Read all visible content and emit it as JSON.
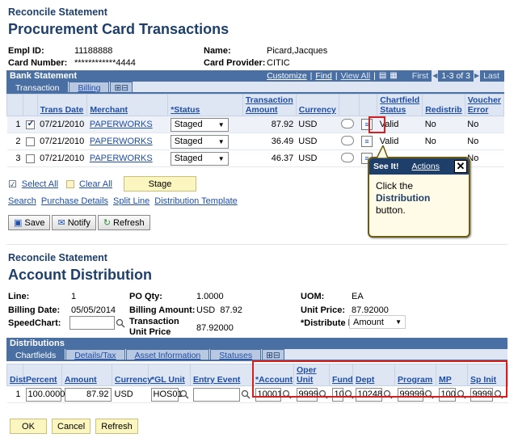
{
  "top": {
    "section": "Reconcile Statement",
    "title": "Procurement Card Transactions",
    "empl_id_label": "Empl ID:",
    "empl_id": "11188888",
    "card_label": "Card Number:",
    "card": "************4444",
    "name_label": "Name:",
    "name": "Picard,Jacques",
    "provider_label": "Card Provider:",
    "provider": "CITIC"
  },
  "bank": {
    "header": "Bank Statement",
    "customize": "Customize",
    "find": "Find",
    "view_all": "View All",
    "first": "First",
    "range": "1-3 of 3",
    "last": "Last",
    "tabs": [
      "Transaction",
      "Billing"
    ],
    "columns": [
      "Trans Date",
      "Merchant",
      "*Status",
      "Transaction Amount",
      "Currency",
      "Chartfield Status",
      "Redistrib",
      "Voucher Error"
    ],
    "rows": [
      {
        "n": "1",
        "checked": true,
        "date": "07/21/2010",
        "merchant": "PAPERWORKS",
        "status": "Staged",
        "amount": "87.92",
        "currency": "USD",
        "cf": "Valid",
        "redist": "No",
        "verr": "No"
      },
      {
        "n": "2",
        "checked": false,
        "date": "07/21/2010",
        "merchant": "PAPERWORKS",
        "status": "Staged",
        "amount": "36.49",
        "currency": "USD",
        "cf": "Valid",
        "redist": "No",
        "verr": "No"
      },
      {
        "n": "3",
        "checked": false,
        "date": "07/21/2010",
        "merchant": "PAPERWORKS",
        "status": "Staged",
        "amount": "46.37",
        "currency": "USD",
        "cf": "",
        "redist": "",
        "verr": "No"
      }
    ]
  },
  "actions": {
    "select_all": "Select All",
    "clear_all": "Clear All",
    "stage": "Stage",
    "links": [
      "Search",
      "Purchase Details",
      "Split Line",
      "Distribution Template"
    ],
    "save": "Save",
    "notify": "Notify",
    "refresh": "Refresh"
  },
  "callout": {
    "see_it": "See It!",
    "actions": "Actions",
    "text_pre": "Click the ",
    "text_bold": "Distribution",
    "text_post": " button."
  },
  "dist": {
    "section": "Reconcile Statement",
    "title": "Account Distribution",
    "line_label": "Line:",
    "line": "1",
    "po_label": "PO Qty:",
    "po": "1.0000",
    "uom_label": "UOM:",
    "uom": "EA",
    "bdate_label": "Billing Date:",
    "bdate": "05/05/2014",
    "bamt_label": "Billing Amount:",
    "bamt": "USD  87.92",
    "price_label": "Unit Price:",
    "price": "87.92000",
    "speed_label": "SpeedChart:",
    "tup_label": "Transaction Unit Price",
    "tup": "87.92000",
    "distby_label": "*Distribute by:",
    "distby": "Amount",
    "header": "Distributions",
    "tabs": [
      "Chartfields",
      "Details/Tax",
      "Asset Information",
      "Statuses"
    ],
    "columns": [
      "Dist",
      "Percent",
      "Amount",
      "Currency",
      "*GL Unit",
      "Entry Event",
      "*Account",
      "Oper Unit",
      "Fund",
      "Dept",
      "Program",
      "MP",
      "Sp Init"
    ],
    "row": {
      "dist": "1",
      "percent": "100.0000",
      "amount": "87.92",
      "currency": "USD",
      "gl": "HOS01",
      "entry": "",
      "account": "10001",
      "oper": "9999",
      "fund": "10",
      "dept": "10248",
      "program": "99999",
      "mp": "100",
      "spinit": "9999"
    }
  },
  "footer": {
    "ok": "OK",
    "cancel": "Cancel",
    "refresh": "Refresh"
  }
}
